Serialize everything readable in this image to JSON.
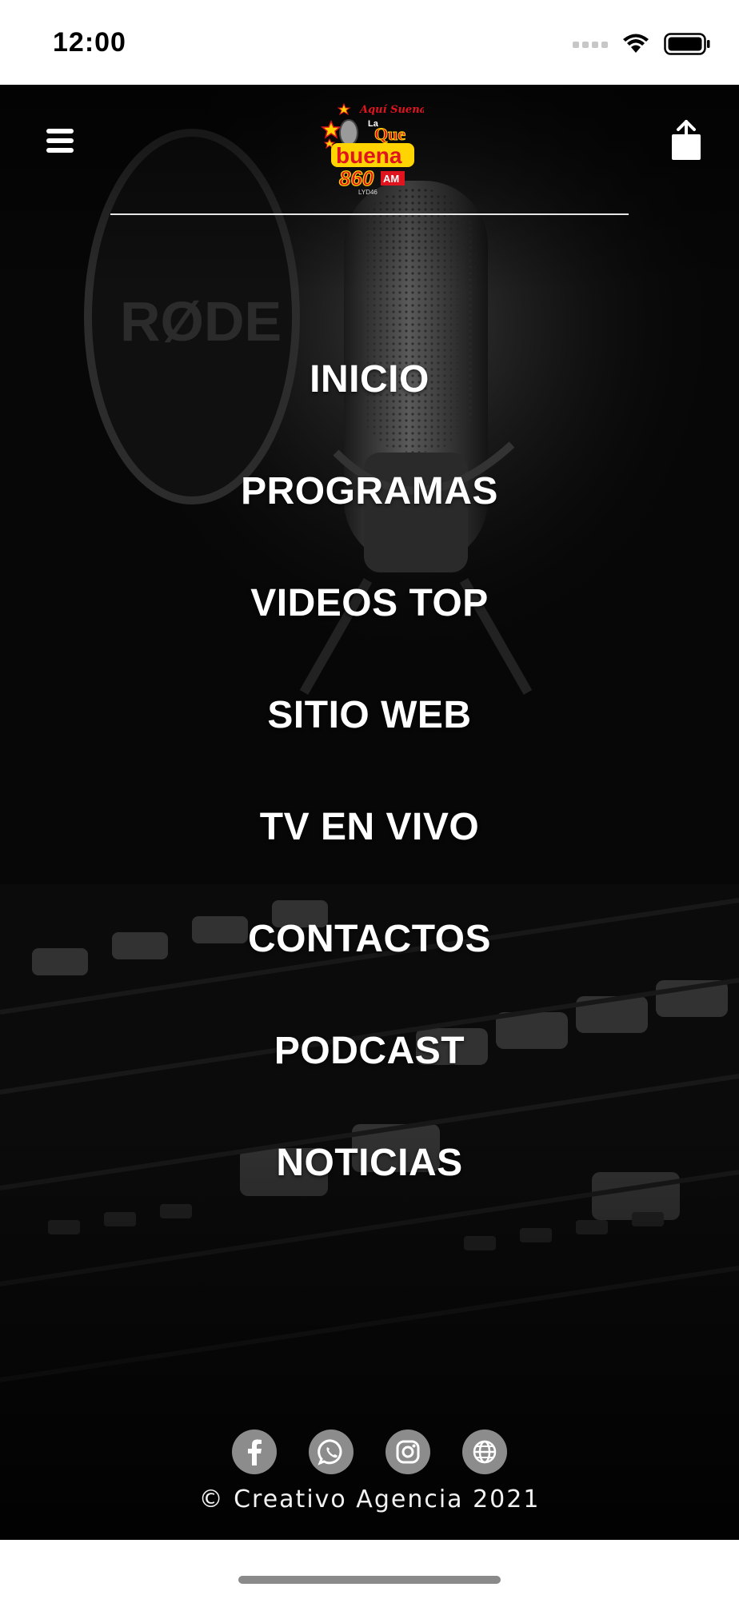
{
  "status_bar": {
    "time": "12:00"
  },
  "header": {
    "logo_tagline": "Aquí Suena..!!",
    "logo_la": "La",
    "logo_que": "Que",
    "logo_buena": "buena",
    "logo_freq": "860",
    "logo_am": "AM",
    "logo_call": "LYD46"
  },
  "menu": {
    "items": [
      {
        "label": "INICIO"
      },
      {
        "label": "PROGRAMAS"
      },
      {
        "label": "VIDEOS TOP"
      },
      {
        "label": "SITIO WEB"
      },
      {
        "label": "TV EN VIVO"
      },
      {
        "label": "CONTACTOS"
      },
      {
        "label": "PODCAST"
      },
      {
        "label": "NOTICIAS"
      }
    ]
  },
  "footer": {
    "social": [
      "facebook-icon",
      "whatsapp-icon",
      "instagram-icon",
      "globe-icon"
    ],
    "copyright": "© Creativo Agencia 2021"
  },
  "colors": {
    "background": "#050505",
    "menu_text": "#ffffff",
    "social_bg": "#8c8c8c",
    "logo_yellow": "#ffd400",
    "logo_red": "#e0141e"
  }
}
